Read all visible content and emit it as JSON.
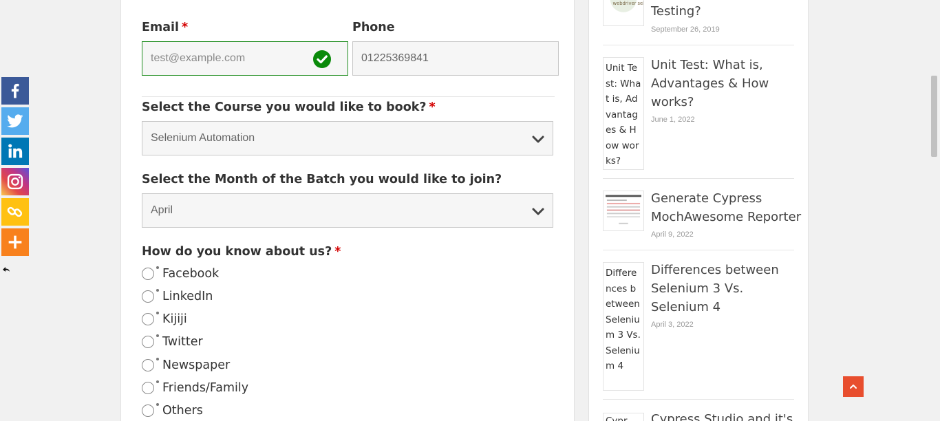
{
  "share": {
    "buttons": [
      {
        "name": "facebook",
        "color": "#3b5998"
      },
      {
        "name": "twitter",
        "color": "#55acee"
      },
      {
        "name": "linkedin",
        "color": "#0077b5"
      },
      {
        "name": "instagram",
        "color": "#c13584"
      },
      {
        "name": "copy-link",
        "color": "#ffc112"
      },
      {
        "name": "more",
        "color": "#f8811d"
      }
    ]
  },
  "form": {
    "email": {
      "label": "Email",
      "required": "*",
      "placeholder": "test@example.com"
    },
    "phone": {
      "label": "Phone",
      "value": "01225369841"
    },
    "course": {
      "label": "Select the Course you would like to book?",
      "required": "*",
      "selected": "Selenium Automation"
    },
    "month": {
      "label": "Select the Month of the Batch you would like to join?",
      "selected": "April"
    },
    "source": {
      "label": "How do you know about us?",
      "required": "*",
      "options": [
        "Facebook",
        "LinkedIn",
        "Kijiji",
        "Twitter",
        "Newspaper",
        "Friends/Family",
        "Others"
      ]
    }
  },
  "sidebar": {
    "posts": [
      {
        "title_tail": "Testing?",
        "date": "September 26, 2019",
        "thumb_text": "webdriver selenium"
      },
      {
        "title": "Unit Test: What is, Advantages & How works?",
        "date": "June 1, 2022",
        "thumb_alt": "Unit Test: What is, Advantages & How works?"
      },
      {
        "title": "Generate Cypress MochAwesome Reporter",
        "date": "April 9, 2022"
      },
      {
        "title": "Differences between Selenium 3 Vs. Selenium 4",
        "date": "April 3, 2022",
        "thumb_alt": "Differences between Selenium 3 Vs. Selenium 4"
      },
      {
        "title": "Cypress Studio and it's",
        "thumb_alt": "Cypr"
      }
    ]
  },
  "colors": {
    "accent": "#e84e2e",
    "required": "#d40000",
    "valid": "#1a8a1a"
  }
}
